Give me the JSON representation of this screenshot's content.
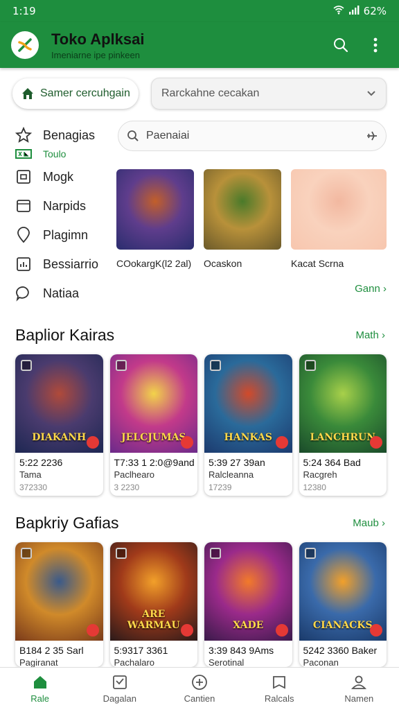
{
  "status": {
    "time": "1:19",
    "battery": "62%"
  },
  "appbar": {
    "title": "Toko Aplksai",
    "subtitle": "Imeniarne ipe pinkeen"
  },
  "toprow": {
    "chip_label": "Samer cercuhgain",
    "select_value": "Rarckahne cecakan"
  },
  "sidebar": {
    "items": [
      {
        "label": "Benagias",
        "icon": "star-icon"
      },
      {
        "label": "Toulo",
        "icon": "folder-icon"
      },
      {
        "label": "Mogk",
        "icon": "image-icon"
      },
      {
        "label": "Narpids",
        "icon": "tablet-icon"
      },
      {
        "label": "Plagimn",
        "icon": "pin-icon"
      },
      {
        "label": "Bessiarrio",
        "icon": "chart-icon"
      },
      {
        "label": "Natiaa",
        "icon": "chat-icon"
      }
    ]
  },
  "search": {
    "value": "Paenaiai"
  },
  "featured": [
    {
      "label": "COokargK(l2 2al)",
      "colors": [
        "#2a2d6e",
        "#5f3d8c",
        "#c25f2a"
      ]
    },
    {
      "label": "Ocaskon",
      "colors": [
        "#6b5a2a",
        "#b8913a",
        "#4a7a2a"
      ]
    },
    {
      "label": "Kacat Scrna",
      "colors": [
        "#f7c6ae",
        "#f9d2bd",
        "#f2b8a0"
      ]
    }
  ],
  "featured_more": "Gann",
  "sections": [
    {
      "title": "Baplior Kairas",
      "more": "Math",
      "cards": [
        {
          "banner": "DIAKANH",
          "line1": "5:22 2236",
          "line2": "Tama",
          "line3": "372330",
          "colors": [
            "#1d2752",
            "#4a3b6e",
            "#b04a3a"
          ]
        },
        {
          "banner": "JELCJUMAS",
          "line1": "T7:33 1 2:0@9and",
          "line2": "Paclhearo",
          "line3": "3 2230",
          "colors": [
            "#6b2a8a",
            "#c23a8a",
            "#f2d34a"
          ]
        },
        {
          "banner": "HANKAS",
          "line1": "5:39 27 39an",
          "line2": "Ralcleanna",
          "line3": "17239",
          "colors": [
            "#1c3a6e",
            "#2a6a9a",
            "#d24a2a"
          ]
        },
        {
          "banner": "LANCHRUN",
          "line1": "5:24 364 Bad",
          "line2": "Racgreh",
          "line3": "12380",
          "colors": [
            "#1a4a2a",
            "#3a8a3a",
            "#a8d04a"
          ]
        }
      ]
    },
    {
      "title": "Bapkriy Gafias",
      "more": "Maub",
      "cards": [
        {
          "banner": "",
          "line1": "B184 2 35 Sarl",
          "line2": "Pagiranat",
          "line3": "",
          "colors": [
            "#7a3a1a",
            "#d08a2a",
            "#3a5a8a"
          ]
        },
        {
          "banner": "ARE WARMAU",
          "line1": "5:9317 3361",
          "line2": "Pachalaro",
          "line3": "",
          "colors": [
            "#2a1a1a",
            "#a03a1a",
            "#f2a02a"
          ]
        },
        {
          "banner": "XADE",
          "line1": "3:39 843 9Ams",
          "line2": "Serotinal",
          "line3": "",
          "colors": [
            "#3a1a4a",
            "#9a2a8a",
            "#f27a2a"
          ]
        },
        {
          "banner": "CIANACKS",
          "line1": "5242 3360 Baker",
          "line2": "Paconan",
          "line3": "",
          "colors": [
            "#1a3a6a",
            "#3a6aaa",
            "#f2a02a"
          ]
        }
      ]
    }
  ],
  "bottomnav": [
    {
      "label": "Rale",
      "icon": "home-icon",
      "active": true
    },
    {
      "label": "Dagalan",
      "icon": "inbox-icon",
      "active": false
    },
    {
      "label": "Cantien",
      "icon": "add-circle-icon",
      "active": false
    },
    {
      "label": "Ralcals",
      "icon": "book-icon",
      "active": false
    },
    {
      "label": "Namen",
      "icon": "person-icon",
      "active": false
    }
  ],
  "theme": {
    "primary": "#1e8e3e",
    "accent_logo": "#f2a31b"
  }
}
